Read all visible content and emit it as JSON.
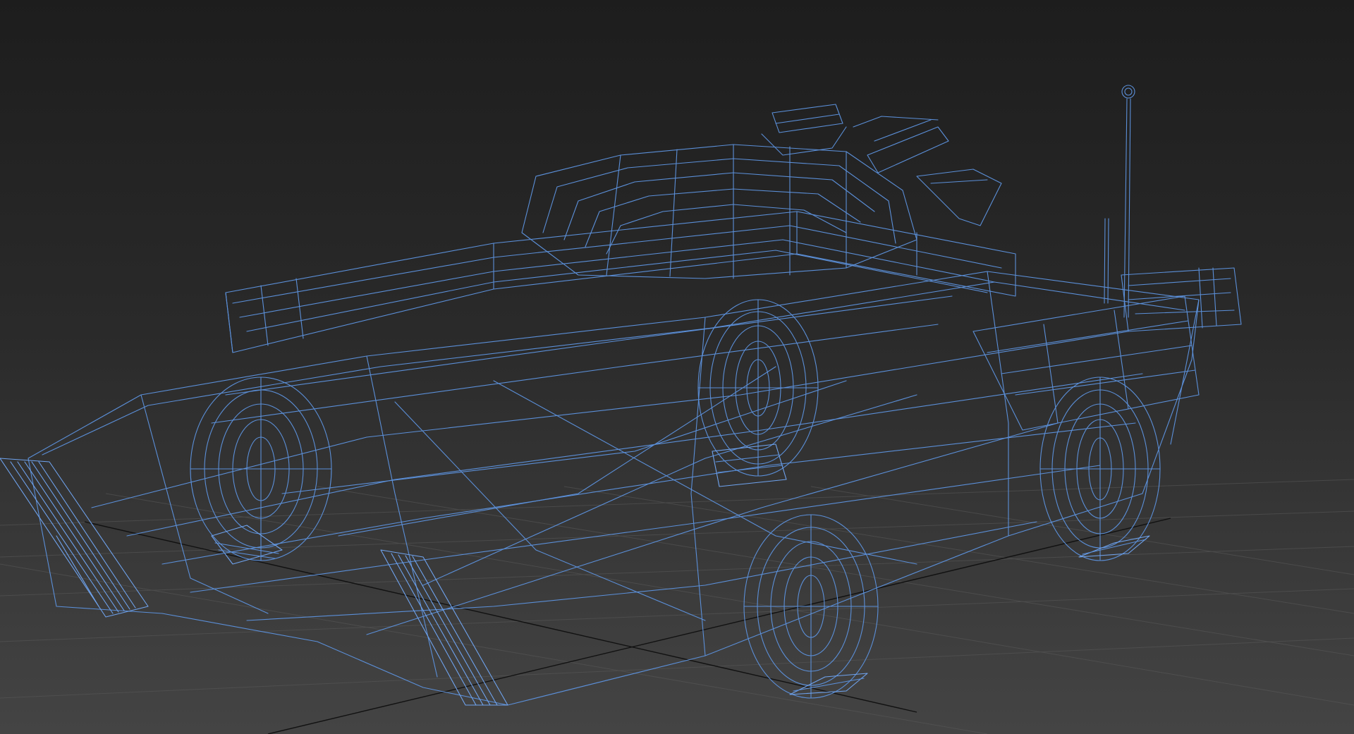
{
  "viewport": {
    "background_top": "#1d1d1d",
    "background_bottom": "#444444",
    "grid_color": "#5a5a5a",
    "axis_color": "#111111"
  },
  "object": {
    "kind": "wireframe-vehicle-model",
    "wire_color": "#5b8fd8",
    "wire_dense_color": "#6fa3ee"
  }
}
